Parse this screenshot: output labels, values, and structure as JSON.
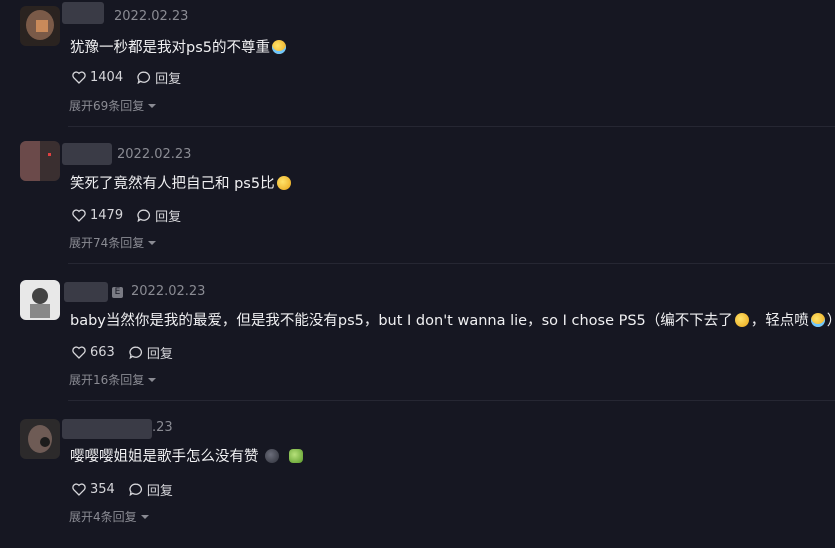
{
  "comments": [
    {
      "date": "2022.02.23",
      "text": "犹豫一秒都是我对ps5的不尊重",
      "emoji_after": [
        "crying-laughing"
      ],
      "likes": "1404",
      "reply_label": "回复",
      "expand_label": "展开69条回复"
    },
    {
      "date": "2022.02.23",
      "text": "笑死了竟然有人把自己和 ps5比",
      "emoji_after": [
        "grinning-squint"
      ],
      "likes": "1479",
      "reply_label": "回复",
      "expand_label": "展开74条回复"
    },
    {
      "date": "2022.02.23",
      "badge": "E",
      "text_part1": "baby当然你是我的最爱，但是我不能没有ps5，but I don't wanna lie，so I chose PS5（编不下去了",
      "text_part2": "，轻点喷",
      "text_part3": "）",
      "likes": "663",
      "reply_label": "回复",
      "expand_label": "展开16条回复"
    },
    {
      "date": "2022.02.23",
      "text": "嘤嘤嘤姐姐是歌手怎么没有赞",
      "emoji_after": [
        "dark-face",
        "green-face"
      ],
      "likes": "354",
      "reply_label": "回复",
      "expand_label": "展开4条回复"
    }
  ]
}
